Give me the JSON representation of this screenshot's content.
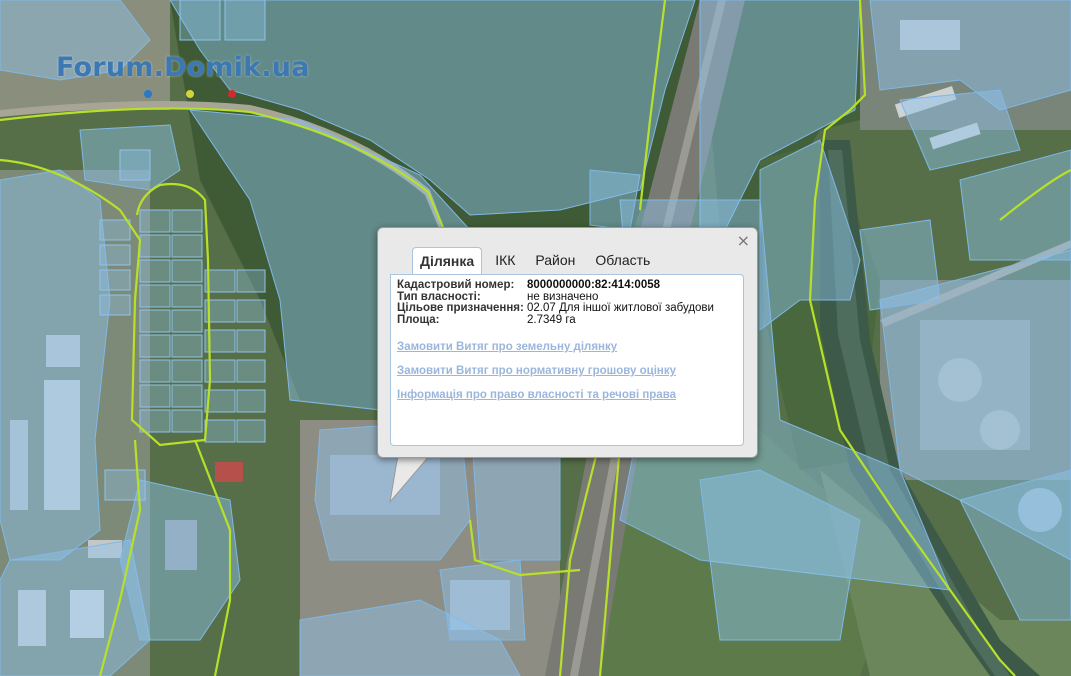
{
  "map": {
    "watermark": "Forum.Domik.ua",
    "colors": {
      "parcel_fill": "#8ec4ee",
      "parcel_stroke": "#7fb8e6",
      "boundary_line": "#b7e02a",
      "forest": "#3f5b35",
      "road": "#7a7a74"
    }
  },
  "popup": {
    "close_icon": "×",
    "tabs": [
      {
        "label": "Ділянка",
        "active": true
      },
      {
        "label": "ІКК",
        "active": false
      },
      {
        "label": "Район",
        "active": false
      },
      {
        "label": "Область",
        "active": false
      }
    ],
    "fields": [
      {
        "label": "Кадастровий номер:",
        "value": "8000000000:82:414:0058"
      },
      {
        "label": "Тип власності:",
        "value": "не визначено"
      },
      {
        "label": "Цільове призначення:",
        "value": "02.07 Для іншої житлової забудови"
      },
      {
        "label": "Площа:",
        "value": "2.7349 га"
      }
    ],
    "links": [
      "Замовити Витяг про земельну ділянку",
      "Замовити Витяг про нормативну грошову оцінку",
      "Інформація про право власності та речові права"
    ]
  }
}
